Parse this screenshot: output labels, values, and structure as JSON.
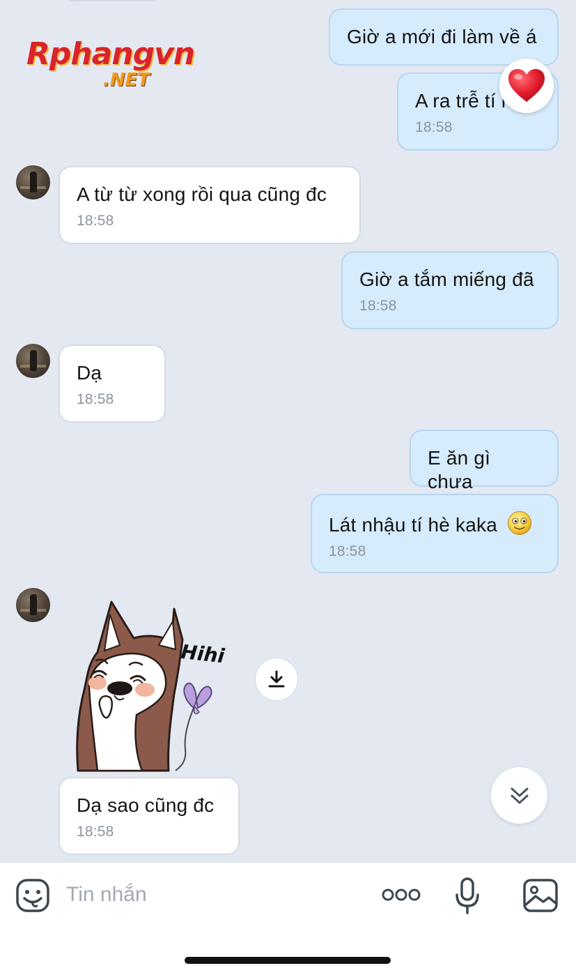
{
  "logo": {
    "main": "Rphangvn",
    "sub": ".NET"
  },
  "messages": [
    {
      "side": "me",
      "text": "Giờ a mới đi làm về á",
      "time": ""
    },
    {
      "side": "me",
      "text": "A ra trễ tí ha",
      "time": "18:58",
      "reaction": "heart-icon"
    },
    {
      "side": "them",
      "text": "A từ từ xong rồi qua cũng đc",
      "time": "18:58"
    },
    {
      "side": "me",
      "text": "Giờ a tắm miếng đã",
      "time": "18:58"
    },
    {
      "side": "them",
      "text": "Dạ",
      "time": "18:58"
    },
    {
      "side": "me",
      "text": "E ăn gì chưa",
      "time": ""
    },
    {
      "side": "me",
      "text": "Lát nhậu tí hè kaka",
      "time": "18:58",
      "emoji": "smiley-emoji"
    },
    {
      "side": "them",
      "type": "sticker",
      "sticker_text": "Hihi"
    },
    {
      "side": "them",
      "text": "Dạ sao cũng đc",
      "time": "18:58"
    }
  ],
  "composer": {
    "placeholder": "Tin nhắn"
  },
  "colors": {
    "outgoing_bubble": "#d6ebfb",
    "incoming_bubble": "#ffffff",
    "background": "#e3e8f1"
  }
}
